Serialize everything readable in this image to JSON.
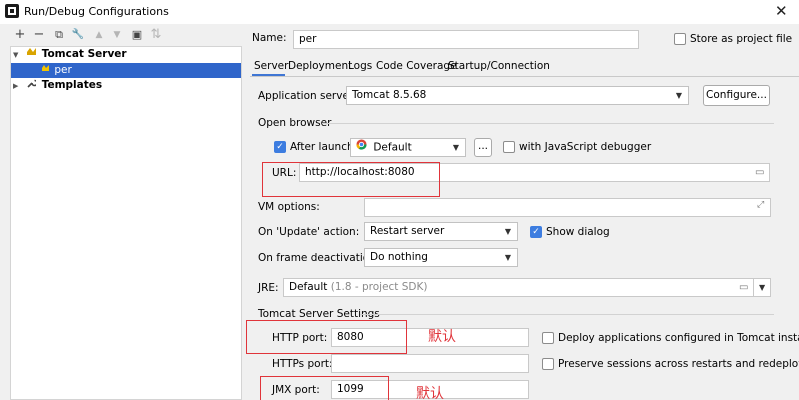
{
  "window": {
    "title": "Run/Debug Configurations",
    "close_symbol": "✕"
  },
  "toolbar": {
    "add": "+",
    "remove": "−",
    "copy": "⧉",
    "wrench": "🔧",
    "up": "▲",
    "down": "▼",
    "folder": "▣",
    "sort": "⇅"
  },
  "tree": {
    "items": [
      {
        "label": "Tomcat Server",
        "expander": "▼"
      },
      {
        "label": "per"
      },
      {
        "label": "Templates",
        "expander": "▶"
      }
    ]
  },
  "name_row": {
    "label": "Name:",
    "value": "per",
    "store_label": "Store as project file",
    "store_checked": false
  },
  "tabs": [
    "Server",
    "Deployment",
    "Logs",
    "Code Coverage",
    "Startup/Connection"
  ],
  "server": {
    "app_server_label": "Application server:",
    "app_server_value": "Tomcat 8.5.68",
    "configure_button": "Configure...",
    "open_browser_label": "Open browser",
    "after_launch_label": "After launch",
    "after_launch_checked": true,
    "browser_value": "Default",
    "browse_button": "...",
    "js_debugger_label": "with JavaScript debugger",
    "url_label": "URL:",
    "url_value": "http://localhost:8080",
    "vm_options_label": "VM options:",
    "vm_options_value": "",
    "on_update_label": "On 'Update' action:",
    "on_update_value": "Restart server",
    "show_dialog_label": "Show dialog",
    "show_dialog_checked": true,
    "on_frame_label": "On frame deactivation:",
    "on_frame_value": "Do nothing",
    "jre_label": "JRE:",
    "jre_value": "Default",
    "jre_hint": "(1.8 - project SDK)",
    "tomcat_settings_label": "Tomcat Server Settings",
    "http_port_label": "HTTP port:",
    "http_port_value": "8080",
    "https_port_label": "HTTPs port:",
    "https_port_value": "",
    "jmx_port_label": "JMX port:",
    "jmx_port_value": "1099",
    "deploy_label": "Deploy applications configured in Tomcat instance",
    "preserve_label": "Preserve sessions across restarts and redeploys"
  },
  "annotations": {
    "http_default": "默认",
    "jmx_default": "默认"
  },
  "colors": {
    "selection": "#2f65ca",
    "accent": "#3d7de0",
    "annotation": "#e0343a"
  }
}
